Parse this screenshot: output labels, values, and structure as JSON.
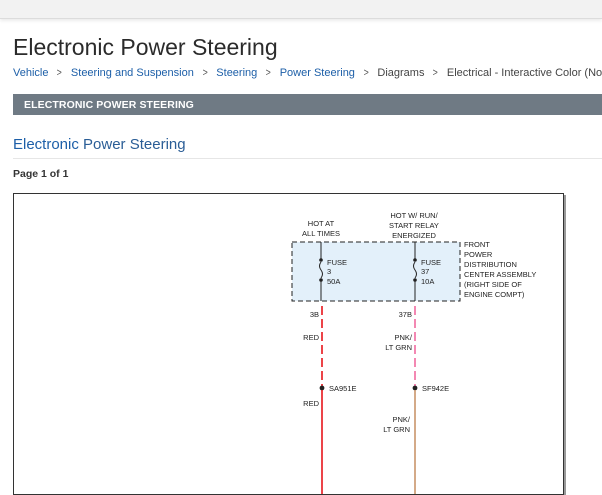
{
  "page_title": "Electronic Power Steering",
  "breadcrumb": {
    "items": [
      "Vehicle",
      "Steering and Suspension",
      "Steering",
      "Power Steering",
      "Diagrams",
      "Electrical - Interactive Color (Non"
    ]
  },
  "section_bar": "ELECTRONIC POWER STEERING",
  "doc_heading": {
    "first": "Electronic",
    "rest": " Power Steering"
  },
  "page_indicator": "Page 1 of 1",
  "diagram": {
    "hot_at_all_times": [
      "HOT AT",
      "ALL TIMES"
    ],
    "hot_run": [
      "HOT W/ RUN/",
      "START RELAY",
      "ENERGIZED"
    ],
    "fuse_left": [
      "FUSE",
      "3",
      "50A"
    ],
    "fuse_right": [
      "FUSE",
      "37",
      "10A"
    ],
    "front_pdc": [
      "FRONT",
      "POWER",
      "DISTRIBUTION",
      "CENTER ASSEMBLY",
      "(RIGHT SIDE OF",
      "ENGINE COMPT)"
    ],
    "pin_left": "3B",
    "pin_right": "37B",
    "wire_left_1": "RED",
    "wire_right_1": [
      "PNK/",
      "LT GRN"
    ],
    "splice_left": "SA951E",
    "splice_right": "SF942E",
    "wire_left_2": "RED",
    "wire_right_2": [
      "PNK/",
      "LT GRN"
    ],
    "colors": {
      "red_wire": "#e8151b",
      "pink_wire": "#f06aa0",
      "tan_wire": "#c9956a",
      "box_fill": "#e3f0fa"
    }
  }
}
